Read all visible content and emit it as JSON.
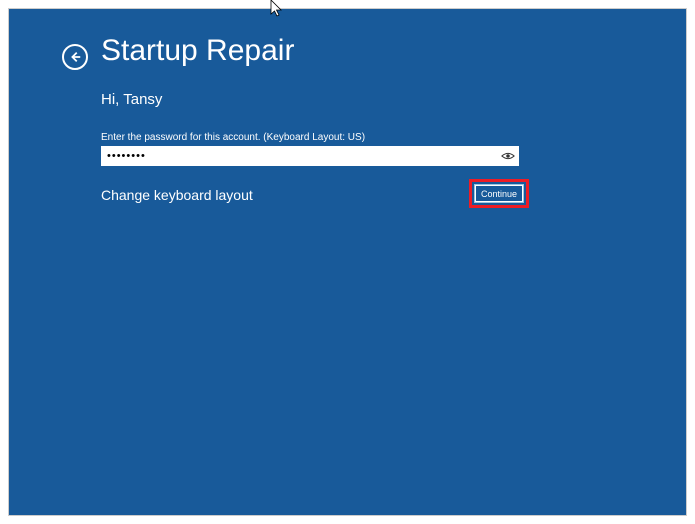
{
  "title": "Startup Repair",
  "greeting": "Hi, Tansy",
  "password": {
    "label": "Enter the password for this account. (Keyboard Layout: US)",
    "value": "••••••••"
  },
  "keyboard_link": "Change keyboard layout",
  "continue_label": "Continue"
}
